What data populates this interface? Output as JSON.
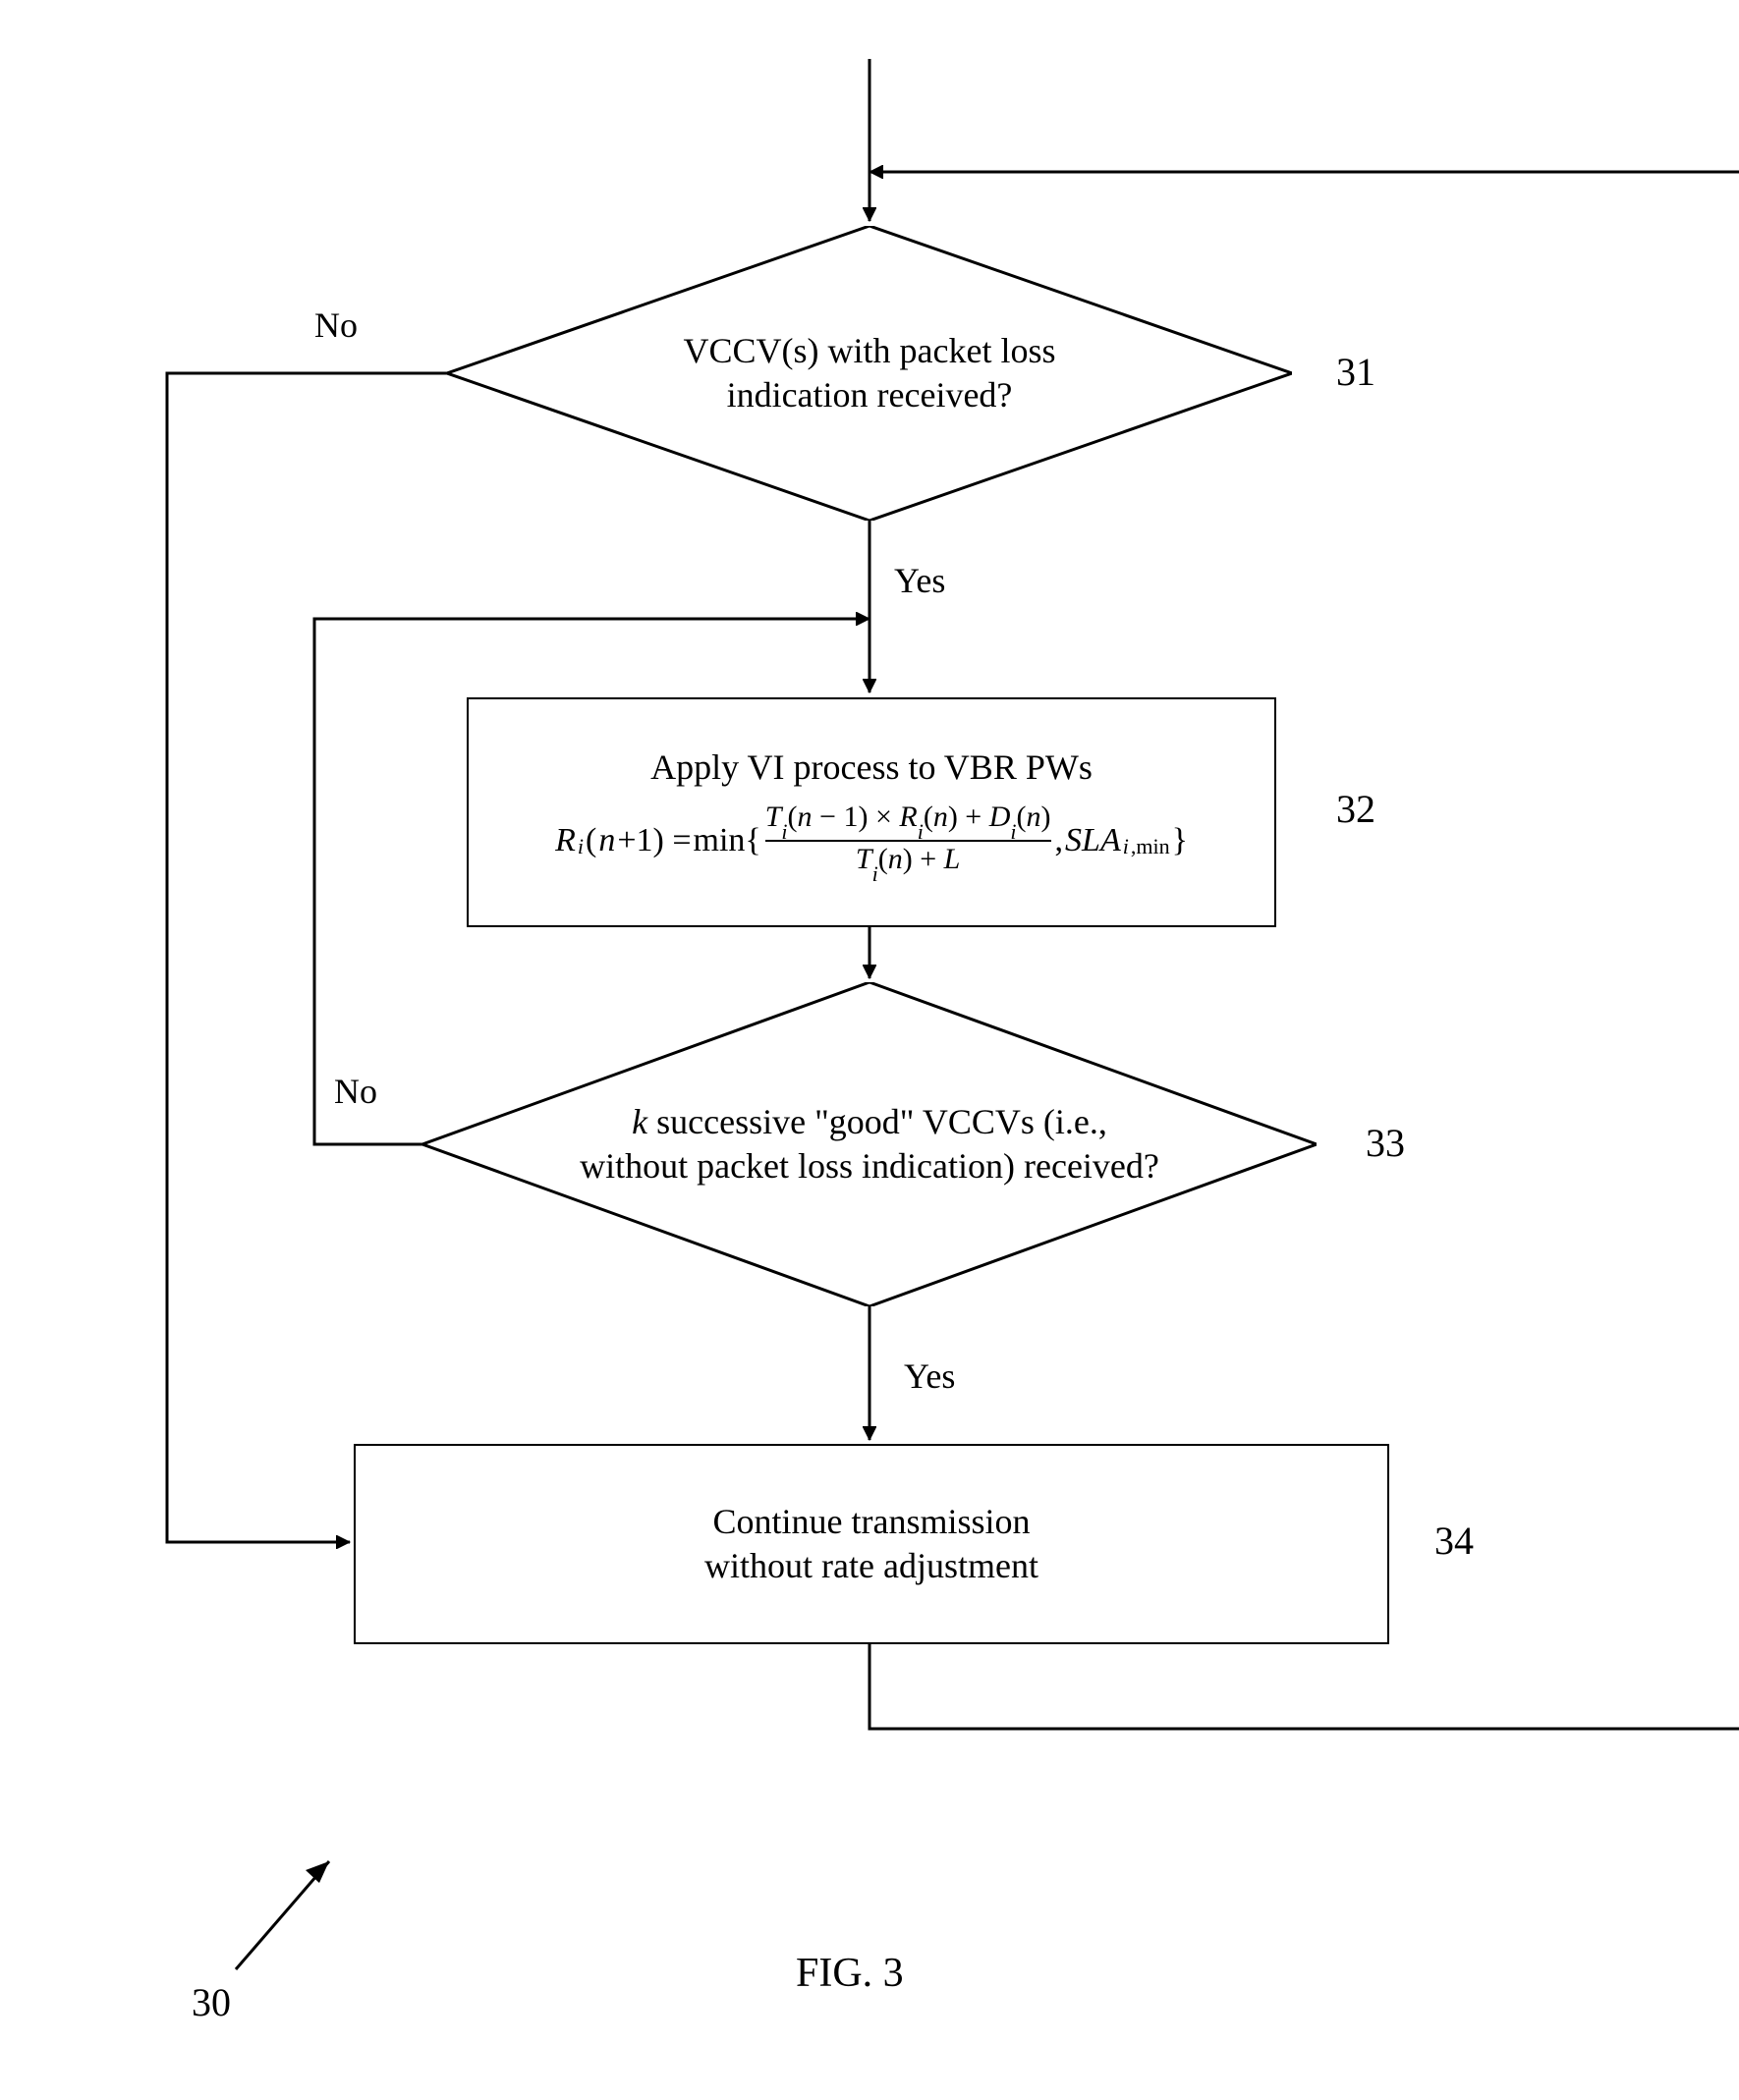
{
  "chart_data": {
    "type": "flowchart",
    "title": "FIG. 3",
    "reference_label": "30",
    "nodes": [
      {
        "id": "31",
        "kind": "decision",
        "text_line1": "VCCV(s) with packet loss",
        "text_line2": "indication received?"
      },
      {
        "id": "32",
        "kind": "process",
        "text_line1": "Apply VI process  to VBR PWs",
        "formula_plain": "R_i(n+1) = min{ (T_i(n-1) × R_i(n) + D_i(n)) / (T_i(n) + L), SLA_{i,min} }"
      },
      {
        "id": "33",
        "kind": "decision",
        "text_line1_prefix_italic": "k",
        "text_line1_rest": " successive \"good\" VCCVs  (i.e.,",
        "text_line2": "without packet loss indication) received?"
      },
      {
        "id": "34",
        "kind": "process",
        "text_line1": "Continue transmission",
        "text_line2": "without rate adjustment"
      }
    ],
    "edges": [
      {
        "from": "entry-top",
        "to": "31"
      },
      {
        "from": "entry-right",
        "to": "31"
      },
      {
        "from": "31",
        "to": "32",
        "label": "Yes"
      },
      {
        "from": "31",
        "to": "34",
        "label": "No",
        "path": "left-down"
      },
      {
        "from": "32",
        "to": "33"
      },
      {
        "from": "33",
        "to": "34",
        "label": "Yes"
      },
      {
        "from": "33",
        "to": "32",
        "label": "No",
        "path": "left-up"
      },
      {
        "from": "34",
        "to": "exit-right"
      }
    ]
  },
  "labels": {
    "no": "No",
    "yes": "Yes",
    "fig": "FIG. 3",
    "ref30": "30",
    "n31": "31",
    "n32": "32",
    "n33": "33",
    "n34": "34"
  }
}
